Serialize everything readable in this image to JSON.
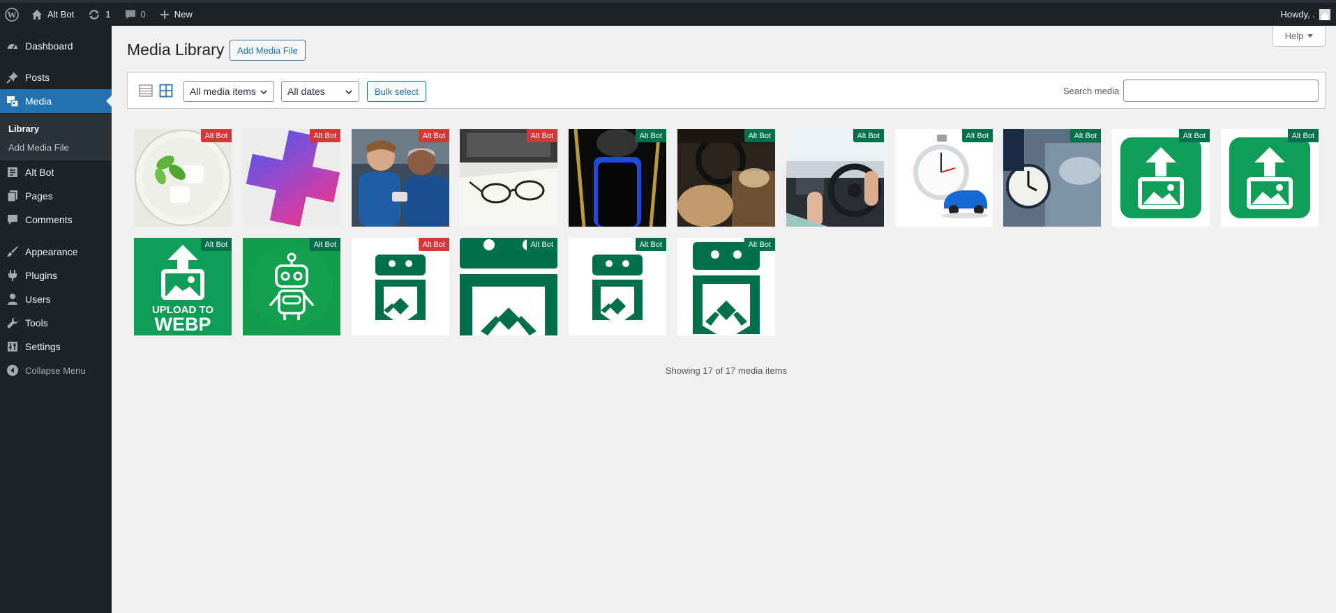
{
  "adminbar": {
    "site_name": "Alt Bot",
    "updates_count": "1",
    "comments_count": "0",
    "new_label": "New",
    "howdy": "Howdy, ."
  },
  "sidebar": {
    "items": [
      {
        "label": "Dashboard",
        "icon": "dashboard-icon"
      },
      {
        "label": "Posts",
        "icon": "pin-icon"
      },
      {
        "label": "Media",
        "icon": "media-icon"
      },
      {
        "label": "Alt Bot",
        "icon": "document-icon"
      },
      {
        "label": "Pages",
        "icon": "pages-icon"
      },
      {
        "label": "Comments",
        "icon": "comment-icon"
      },
      {
        "label": "Appearance",
        "icon": "brush-icon"
      },
      {
        "label": "Plugins",
        "icon": "plugin-icon"
      },
      {
        "label": "Users",
        "icon": "user-icon"
      },
      {
        "label": "Tools",
        "icon": "wrench-icon"
      },
      {
        "label": "Settings",
        "icon": "sliders-icon"
      },
      {
        "label": "Collapse Menu",
        "icon": "collapse-icon"
      }
    ],
    "submenu": [
      "Library",
      "Add Media File"
    ]
  },
  "help_label": "Help",
  "page_title": "Media Library",
  "add_media_label": "Add Media File",
  "toolbar": {
    "filter_types": "All media items",
    "filter_dates": "All dates",
    "bulk_select": "Bulk select",
    "search_label": "Search media",
    "search_value": ""
  },
  "media_items": [
    {
      "badge": "Alt Bot",
      "status": "red",
      "thumb": "mint-drink"
    },
    {
      "badge": "Alt Bot",
      "status": "red",
      "thumb": "gradient-cross"
    },
    {
      "badge": "Alt Bot",
      "status": "red",
      "thumb": "people-in-car"
    },
    {
      "badge": "Alt Bot",
      "status": "red",
      "thumb": "glasses-on-book"
    },
    {
      "badge": "Alt Bot",
      "status": "green",
      "thumb": "car-top-view"
    },
    {
      "badge": "Alt Bot",
      "status": "green",
      "thumb": "car-interior"
    },
    {
      "badge": "Alt Bot",
      "status": "green",
      "thumb": "steering-wheel"
    },
    {
      "badge": "Alt Bot",
      "status": "green",
      "thumb": "stopwatch-car"
    },
    {
      "badge": "Alt Bot",
      "status": "green",
      "thumb": "clock-car"
    },
    {
      "badge": "Alt Bot",
      "status": "green",
      "thumb": "upload-icon-green"
    },
    {
      "badge": "Alt Bot",
      "status": "green",
      "thumb": "upload-icon-green"
    },
    {
      "badge": "Alt Bot",
      "status": "green",
      "thumb": "upload-webp",
      "thumb_text": [
        "UPLOAD TO",
        "WEBP"
      ]
    },
    {
      "badge": "Alt Bot",
      "status": "green",
      "thumb": "robot"
    },
    {
      "badge": "Alt Bot",
      "status": "red",
      "thumb": "logo-small"
    },
    {
      "badge": "Alt Bot",
      "status": "green",
      "thumb": "logo-large"
    },
    {
      "badge": "Alt Bot",
      "status": "green",
      "thumb": "logo-small"
    },
    {
      "badge": "Alt Bot",
      "status": "green",
      "thumb": "logo-medium"
    }
  ],
  "showing_text": "Showing 17 of 17 media items",
  "colors": {
    "accent": "#2271b1",
    "badge_red": "#d63638",
    "badge_green": "#00704a",
    "brand_green": "#0f9d58",
    "logo_green": "#00704a"
  }
}
